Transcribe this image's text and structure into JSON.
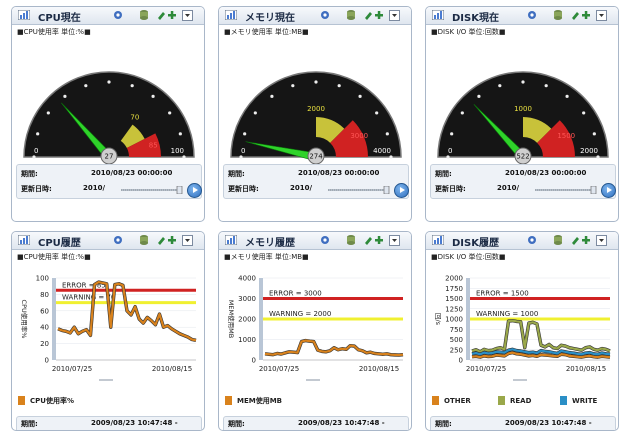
{
  "toolbar_icons": [
    "gear-icon",
    "database-icon",
    "arrows-add-icon",
    "dropdown-icon"
  ],
  "colors": {
    "green": "#2fd32a",
    "yellow": "#c8c23a",
    "red": "#d02222",
    "orange": "#d9821c",
    "olive": "#9aa84a",
    "blue": "#2a8fc6"
  },
  "gauges": [
    {
      "title": "CPU現在",
      "unit_text": "■CPU使用率 単位:%■",
      "value": 27,
      "value_label": "27",
      "min_label": "0",
      "max_label": "100",
      "warn_label": "70",
      "err_label": "85",
      "min": 0,
      "max": 100,
      "warn": 70,
      "err": 85,
      "period_label": "期間:",
      "period_value": "2010/08/23 00:00:00",
      "updated_label": "更新日時:",
      "updated_value": "2010/"
    },
    {
      "title": "メモリ現在",
      "unit_text": "■メモリ使用率 単位:MB■",
      "value": 274,
      "value_label": "274",
      "min_label": "0",
      "max_label": "4000",
      "warn_label": "2000",
      "err_label": "3000",
      "min": 0,
      "max": 4000,
      "warn": 2000,
      "err": 3000,
      "period_label": "期間:",
      "period_value": "2010/08/23 00:00:00",
      "updated_label": "更新日時:",
      "updated_value": "2010/"
    },
    {
      "title": "DISK現在",
      "unit_text": "■DISK I/O 単位:回数■",
      "value": 522,
      "value_label": "522",
      "min_label": "0",
      "max_label": "2000",
      "warn_label": "1000",
      "err_label": "1500",
      "min": 0,
      "max": 2000,
      "warn": 1000,
      "err": 1500,
      "period_label": "期間:",
      "period_value": "2010/08/23 00:00:00",
      "updated_label": "更新日時:",
      "updated_value": "2010/"
    }
  ],
  "histories": [
    {
      "title": "CPU履歴",
      "unit_text": "■CPU使用率 単位:%■",
      "ylabel": "CPU使用率%",
      "foot_label": "期間:",
      "foot_value": "2009/08/23 10:47:48 -"
    },
    {
      "title": "メモリ履歴",
      "unit_text": "■メモリ使用率 単位:MB■",
      "ylabel": "MEM使用MB",
      "foot_label": "期間:",
      "foot_value": "2009/08/23 10:47:48 -"
    },
    {
      "title": "DISK履歴",
      "unit_text": "■DISK I/O 単位:回数■",
      "ylabel": "回/s",
      "foot_label": "期間:",
      "foot_value": "2009/08/23 10:47:48 -"
    }
  ],
  "chart_data": [
    {
      "type": "line",
      "ylim": [
        0,
        100
      ],
      "yticks": [
        "0",
        "20",
        "40",
        "60",
        "80",
        "100"
      ],
      "x_tick_labels": [
        "2010/07/25",
        "2010/08/15"
      ],
      "lines": [
        {
          "text": "ERROR = 85",
          "value": 85,
          "color": "#d02222"
        },
        {
          "text": "WARNING = 70",
          "value": 70,
          "color": "#f0f030"
        }
      ],
      "series": [
        {
          "name": "CPU使用率%",
          "color": "#d9821c",
          "values": [
            38,
            36,
            35,
            33,
            40,
            32,
            35,
            37,
            30,
            92,
            95,
            94,
            93,
            40,
            92,
            93,
            91,
            60,
            55,
            65,
            50,
            45,
            52,
            48,
            43,
            56,
            40,
            42,
            38,
            35,
            32,
            30,
            28,
            25,
            24
          ]
        }
      ]
    },
    {
      "type": "line",
      "ylim": [
        0,
        4000
      ],
      "yticks": [
        "0",
        "1000",
        "2000",
        "3000",
        "4000"
      ],
      "x_tick_labels": [
        "2010/07/25",
        "2010/08/15"
      ],
      "lines": [
        {
          "text": "ERROR = 3000",
          "value": 3000,
          "color": "#d02222"
        },
        {
          "text": "WARNING = 2000",
          "value": 2000,
          "color": "#f0f030"
        }
      ],
      "series": [
        {
          "name": "MEM使用MB",
          "color": "#d9821c",
          "values": [
            300,
            280,
            260,
            320,
            290,
            350,
            400,
            380,
            360,
            900,
            950,
            920,
            900,
            480,
            420,
            400,
            450,
            600,
            500,
            550,
            520,
            700,
            680,
            500,
            450,
            350,
            380,
            320,
            300,
            280,
            300,
            260,
            250,
            240,
            260
          ]
        }
      ]
    },
    {
      "type": "line",
      "ylim": [
        0,
        2000
      ],
      "yticks": [
        "0",
        "250",
        "500",
        "750",
        "1000",
        "1250",
        "1500",
        "1750",
        "2000"
      ],
      "x_tick_labels": [
        "2010/07/25",
        "2010/08/15"
      ],
      "lines": [
        {
          "text": "ERROR = 1500",
          "value": 1500,
          "color": "#d02222"
        },
        {
          "text": "WARNING = 1000",
          "value": 1000,
          "color": "#f0f030"
        }
      ],
      "series": [
        {
          "name": "OTHER",
          "color": "#d9821c",
          "values": [
            80,
            90,
            70,
            100,
            85,
            90,
            120,
            110,
            100,
            160,
            180,
            150,
            140,
            120,
            100,
            110,
            90,
            130,
            120,
            110,
            100,
            90,
            140,
            130,
            100,
            90,
            80,
            70,
            90,
            100,
            80,
            70,
            90,
            80,
            70
          ]
        },
        {
          "name": "READ",
          "color": "#9aa84a",
          "values": [
            220,
            250,
            200,
            260,
            230,
            240,
            280,
            300,
            260,
            950,
            960,
            940,
            930,
            300,
            900,
            920,
            880,
            360,
            320,
            380,
            300,
            280,
            360,
            340,
            300,
            280,
            260,
            240,
            300,
            320,
            260,
            240,
            280,
            260,
            220
          ]
        },
        {
          "name": "WRITE",
          "color": "#2a8fc6",
          "values": [
            150,
            170,
            140,
            180,
            160,
            170,
            200,
            190,
            180,
            240,
            260,
            230,
            220,
            200,
            180,
            190,
            170,
            230,
            210,
            200,
            180,
            160,
            220,
            200,
            180,
            170,
            150,
            140,
            170,
            180,
            150,
            140,
            170,
            150,
            140
          ]
        }
      ]
    }
  ]
}
